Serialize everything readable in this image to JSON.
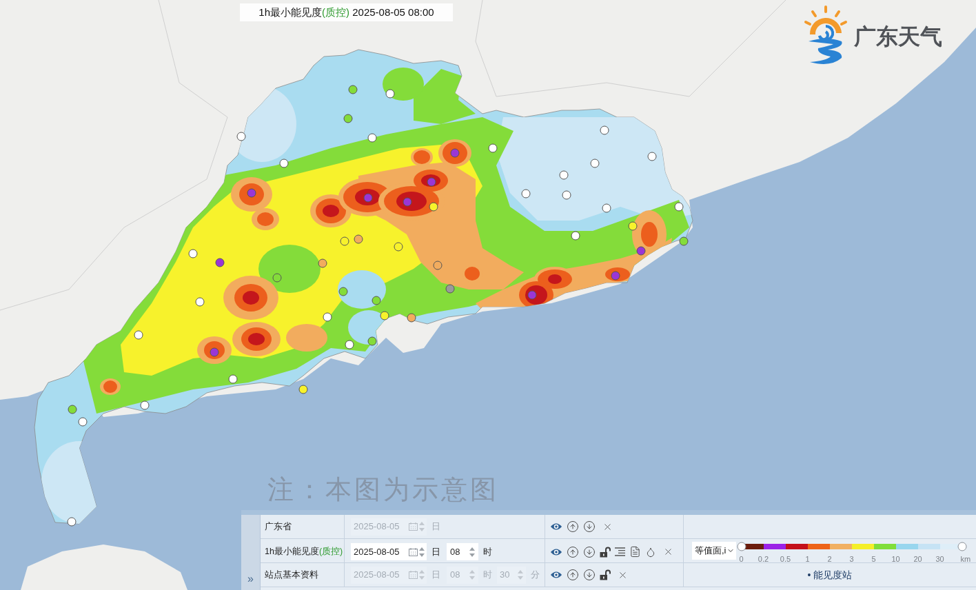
{
  "map_title": {
    "name": "1h最小能见度",
    "qc_tag": "(质控)",
    "datetime": "2025-08-05 08:00"
  },
  "logo": {
    "text": "广东天气"
  },
  "note": "注：本图为示意图",
  "layer_panel": {
    "collapse_button": "»",
    "layers": [
      {
        "kind": "region",
        "name": "广东省",
        "date": "2025-08-05",
        "date_unit": "日",
        "disabled": true
      },
      {
        "kind": "grid",
        "name": "1h最小能见度",
        "qc_tag": "(质控)",
        "date": "2025-08-05",
        "date_unit": "日",
        "hour": "08",
        "hour_unit": "时",
        "disabled": false,
        "render_mode": "等值面,i",
        "scale": [
          {
            "label": "0",
            "color": "#6b1c0c"
          },
          {
            "label": "0.2",
            "color": "#9b22e6"
          },
          {
            "label": "0.5",
            "color": "#c4101a"
          },
          {
            "label": "1",
            "color": "#ee6318"
          },
          {
            "label": "2",
            "color": "#f1b062"
          },
          {
            "label": "3",
            "color": "#f4ef2a"
          },
          {
            "label": "5",
            "color": "#80de3a"
          },
          {
            "label": "10",
            "color": "#98d6ee"
          },
          {
            "label": "20",
            "color": "#c6e3f5"
          },
          {
            "label": "30",
            "color": "#deeef8"
          }
        ],
        "unit": "km",
        "handles": [
          {
            "level": 0
          },
          {
            "level": 1
          }
        ]
      },
      {
        "kind": "station",
        "name": "站点基本资料",
        "date": "2025-08-05",
        "date_unit": "日",
        "hour": "08",
        "hour_unit": "时",
        "minute": "30",
        "minute_unit": "分",
        "disabled": true,
        "legend": "• 能见度站"
      }
    ]
  }
}
